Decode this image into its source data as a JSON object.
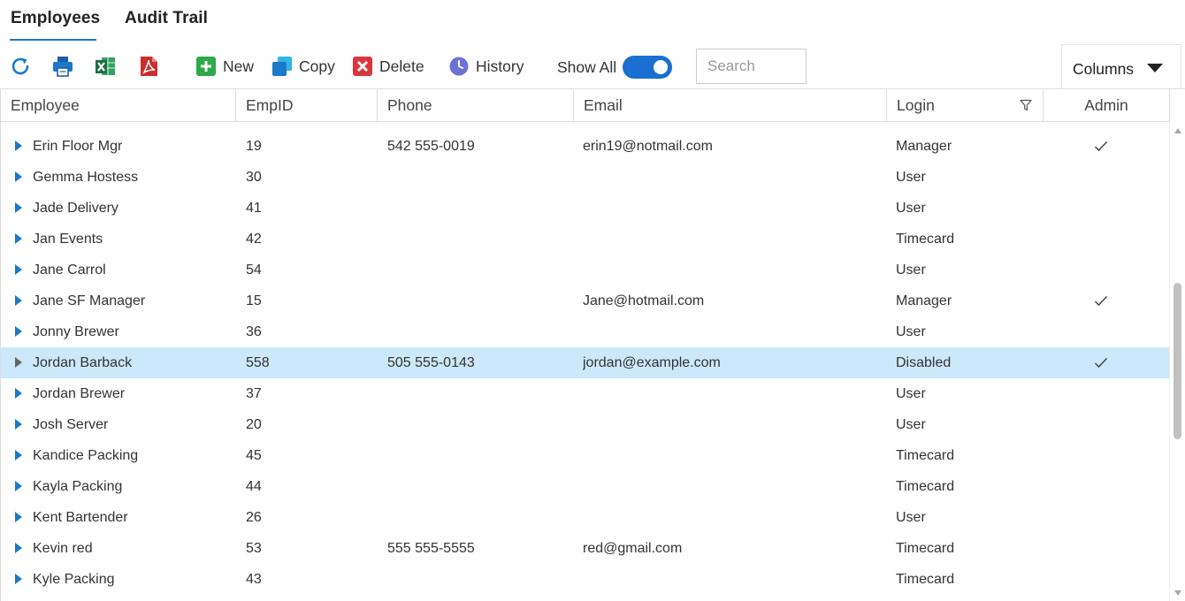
{
  "tabs": [
    {
      "label": "Employees",
      "active": true
    },
    {
      "label": "Audit Trail",
      "active": false
    }
  ],
  "toolbar": {
    "refresh_icon": "refresh-icon",
    "print_icon": "printer-icon",
    "excel_icon": "excel-icon",
    "pdf_icon": "pdf-icon",
    "new_label": "New",
    "copy_label": "Copy",
    "delete_label": "Delete",
    "history_label": "History",
    "show_all_label": "Show All",
    "show_all_on": true,
    "search_placeholder": "Search",
    "columns_label": "Columns"
  },
  "grid": {
    "columns": [
      "Employee",
      "EmpID",
      "Phone",
      "Email",
      "Login",
      "Admin"
    ],
    "rows": [
      {
        "name": "Erin Floor Mgr",
        "empid": "19",
        "phone": "542 555-0019",
        "email": "erin19@notmail.com",
        "login": "Manager",
        "admin": true
      },
      {
        "name": "Gemma Hostess",
        "empid": "30",
        "phone": "",
        "email": "",
        "login": "User",
        "admin": false
      },
      {
        "name": "Jade Delivery",
        "empid": "41",
        "phone": "",
        "email": "",
        "login": "User",
        "admin": false
      },
      {
        "name": "Jan Events",
        "empid": "42",
        "phone": "",
        "email": "",
        "login": "Timecard",
        "admin": false
      },
      {
        "name": "Jane Carrol",
        "empid": "54",
        "phone": "",
        "email": "",
        "login": "User",
        "admin": false
      },
      {
        "name": "Jane SF Manager",
        "empid": "15",
        "phone": "",
        "email": "Jane@hotmail.com",
        "login": "Manager",
        "admin": true
      },
      {
        "name": "Jonny Brewer",
        "empid": "36",
        "phone": "",
        "email": "",
        "login": "User",
        "admin": false
      },
      {
        "name": "Jordan Barback",
        "empid": "558",
        "phone": "505 555-0143",
        "email": "jordan@example.com",
        "login": "Disabled",
        "admin": true,
        "selected": true
      },
      {
        "name": "Jordan Brewer",
        "empid": "37",
        "phone": "",
        "email": "",
        "login": "User",
        "admin": false
      },
      {
        "name": "Josh Server",
        "empid": "20",
        "phone": "",
        "email": "",
        "login": "User",
        "admin": false
      },
      {
        "name": "Kandice Packing",
        "empid": "45",
        "phone": "",
        "email": "",
        "login": "Timecard",
        "admin": false
      },
      {
        "name": "Kayla Packing",
        "empid": "44",
        "phone": "",
        "email": "",
        "login": "Timecard",
        "admin": false
      },
      {
        "name": "Kent Bartender",
        "empid": "26",
        "phone": "",
        "email": "",
        "login": "User",
        "admin": false
      },
      {
        "name": "Kevin red",
        "empid": "53",
        "phone": "555 555-5555",
        "email": "red@gmail.com",
        "login": "Timecard",
        "admin": false
      },
      {
        "name": "Kyle Packing",
        "empid": "43",
        "phone": "",
        "email": "",
        "login": "Timecard",
        "admin": false
      }
    ]
  },
  "colors": {
    "accent": "#1a7ac9",
    "toggle": "#1a6fd0",
    "selected_row": "#cce8fb",
    "caret": "#1a7ac9",
    "caret_selected": "#666666"
  }
}
